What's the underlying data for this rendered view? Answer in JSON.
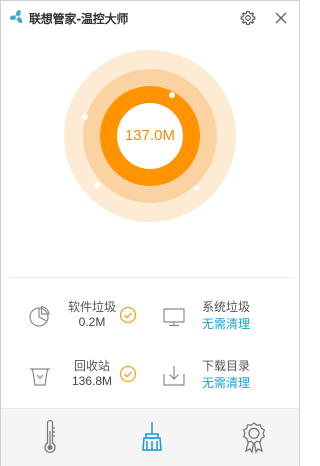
{
  "window": {
    "title": "联想管家-温控大师"
  },
  "titlebar": {
    "icons": [
      "fan-icon",
      "settings-icon",
      "close-icon"
    ]
  },
  "gauge": {
    "value": "137.0M",
    "colors": {
      "outer_ring": "#fdebd4",
      "middle_ring": "#fbd3a2",
      "inner_ring": "#ff9400",
      "value_text": "#f08c00"
    }
  },
  "items": {
    "software_junk": {
      "name": "软件垃圾",
      "value": "0.2M",
      "icon": "pie-chart-icon",
      "status_icon": "check-circle-icon"
    },
    "system_junk": {
      "name": "系统垃圾",
      "value": "无需清理",
      "icon": "monitor-icon"
    },
    "recycle_bin": {
      "name": "回收站",
      "value": "136.8M",
      "icon": "trash-icon",
      "status_icon": "check-circle-icon"
    },
    "download_dir": {
      "name": "下载目录",
      "value": "无需清理",
      "icon": "download-icon"
    }
  },
  "colors": {
    "accent_blue": "#17a3d6",
    "check_orange": "#f5a623"
  },
  "bottom_nav": {
    "items": [
      "thermometer-icon",
      "broom-icon",
      "award-icon"
    ],
    "active": "broom-icon"
  }
}
